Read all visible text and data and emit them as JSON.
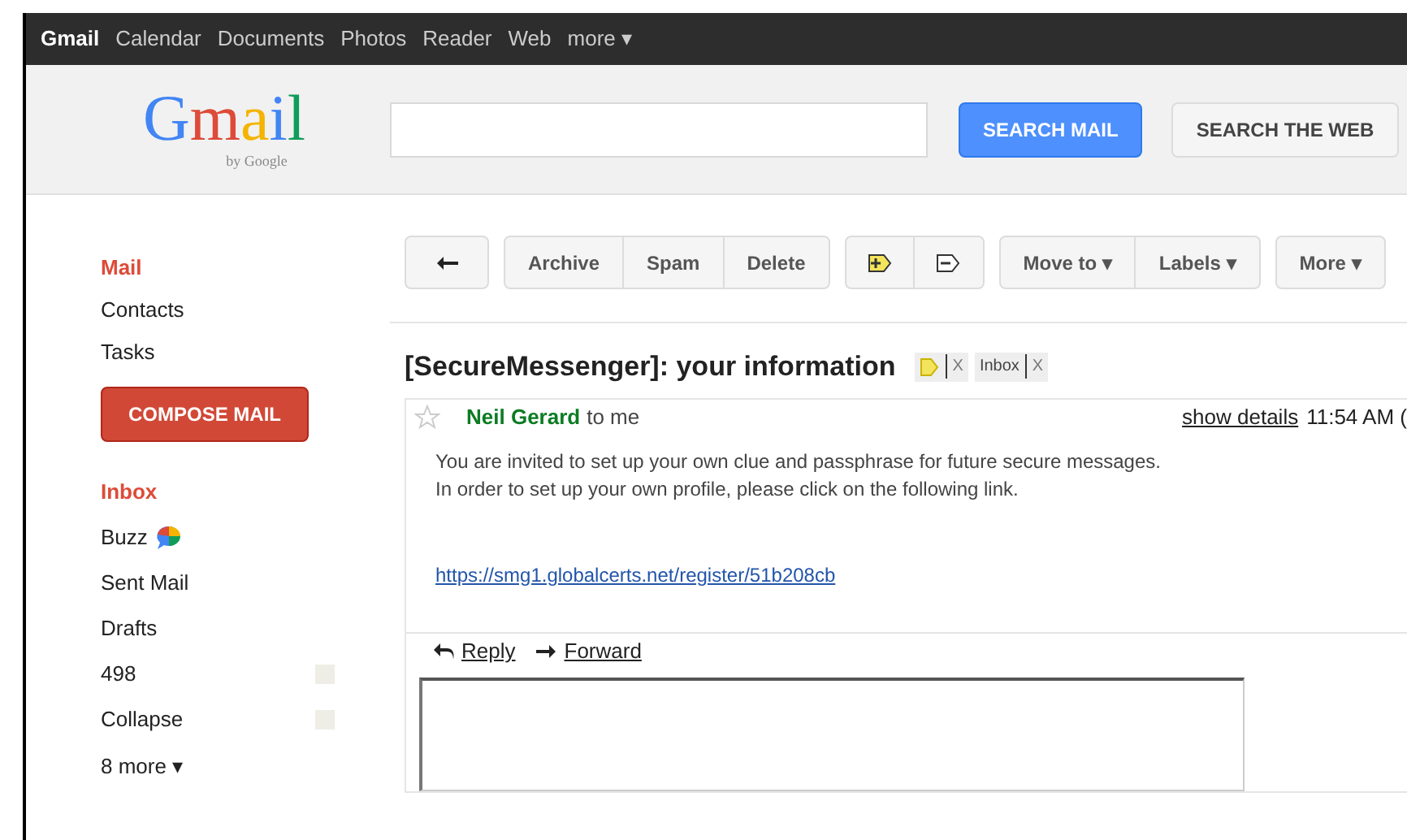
{
  "top_nav": [
    {
      "label": "Gmail",
      "selected": true
    },
    {
      "label": "Calendar",
      "selected": false
    },
    {
      "label": "Documents",
      "selected": false
    },
    {
      "label": "Photos",
      "selected": false
    },
    {
      "label": "Reader",
      "selected": false
    },
    {
      "label": "Web",
      "selected": false
    },
    {
      "label": "more ▾",
      "selected": false
    }
  ],
  "logo": {
    "text": "Gmail",
    "byline": "by Google"
  },
  "search": {
    "search_mail": "SEARCH MAIL",
    "search_web": "SEARCH THE WEB"
  },
  "sidebar": {
    "apps": [
      {
        "label": "Mail",
        "selected": true
      },
      {
        "label": "Contacts",
        "selected": false
      },
      {
        "label": "Tasks",
        "selected": false
      }
    ],
    "compose": "COMPOSE MAIL",
    "folders": [
      {
        "label": "Inbox",
        "selected": true,
        "kind": "folder"
      },
      {
        "label": "Buzz",
        "selected": false,
        "kind": "buzz"
      },
      {
        "label": "Sent Mail",
        "selected": false,
        "kind": "folder"
      },
      {
        "label": "Drafts",
        "selected": false,
        "kind": "folder"
      }
    ],
    "labels": [
      {
        "label": "498",
        "color": "#eeeee6"
      },
      {
        "label": "Collapse",
        "color": "#eeeee6"
      }
    ],
    "more": "8 more ▾"
  },
  "toolbar": {
    "groups": [
      [
        {
          "kind": "back"
        }
      ],
      [
        {
          "kind": "text",
          "label": "Archive"
        },
        {
          "kind": "text",
          "label": "Spam"
        },
        {
          "kind": "text",
          "label": "Delete"
        }
      ],
      [
        {
          "kind": "add-label"
        },
        {
          "kind": "remove-label"
        }
      ],
      [
        {
          "kind": "text",
          "label": "Move to ▾"
        },
        {
          "kind": "text",
          "label": "Labels ▾"
        }
      ],
      [
        {
          "kind": "text",
          "label": "More ▾"
        }
      ]
    ]
  },
  "message": {
    "subject": "[SecureMessenger]: your information",
    "tags": [
      {
        "kind": "color",
        "remove": "X",
        "color": "#f3e45c"
      },
      {
        "kind": "text",
        "label": "Inbox",
        "remove": "X"
      }
    ],
    "starred": false,
    "sender": "Neil Gerard",
    "recipient": "to me",
    "show_details": "show details",
    "time": "11:54 AM (",
    "body": [
      "You are invited to set up your own clue and passphrase for future secure messages.",
      "In order to set up your own profile, please click on the following link."
    ],
    "link": "https://smg1.globalcerts.net/register/51b208cb",
    "reply": "Reply",
    "forward": "Forward"
  }
}
